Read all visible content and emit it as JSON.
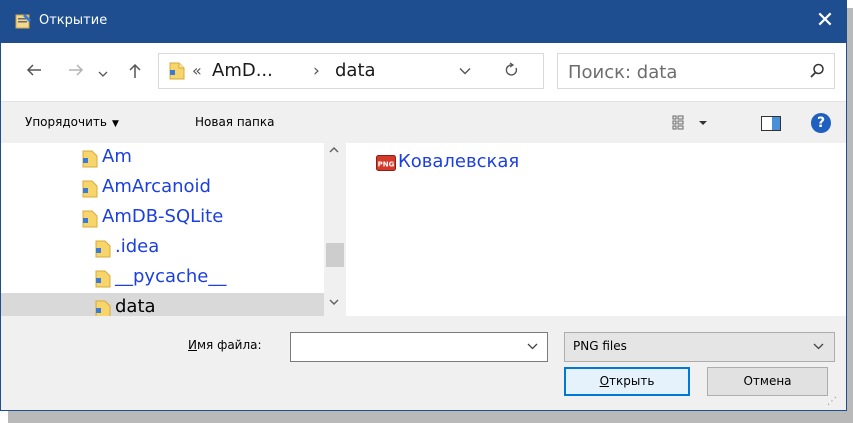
{
  "window": {
    "title": "Открытие",
    "close_label": "✕",
    "accent_color": "#1e4e90"
  },
  "navigation": {
    "back_icon": "arrow-left-icon",
    "forward_icon": "arrow-right-icon",
    "recent_icon": "chevron-down-icon",
    "up_icon": "arrow-up-icon"
  },
  "address": {
    "overflow_marker": "«",
    "crumbs": [
      "AmD...",
      "data"
    ],
    "separator": "›"
  },
  "search": {
    "placeholder": "Поиск: data"
  },
  "toolbar": {
    "organize_label": "Упорядочить",
    "new_folder_label": "Новая папка"
  },
  "tree": {
    "items": [
      {
        "label": "Am",
        "level": 1
      },
      {
        "label": "AmArcanoid",
        "level": 1
      },
      {
        "label": "AmDB-SQLite",
        "level": 1
      },
      {
        "label": ".idea",
        "level": 2
      },
      {
        "label": "__pycache__",
        "level": 2
      },
      {
        "label": "data",
        "level": 2,
        "selected": true
      }
    ]
  },
  "files": {
    "items": [
      {
        "label": "Ковалевская",
        "icon": "png-file-icon"
      }
    ]
  },
  "bottom": {
    "filename_label_underlined": "И",
    "filename_label_rest": "мя файла:",
    "filename_value": "",
    "filetype_value": "PNG files",
    "open_underlined": "О",
    "open_rest": "ткрыть",
    "cancel_label": "Отмена"
  }
}
